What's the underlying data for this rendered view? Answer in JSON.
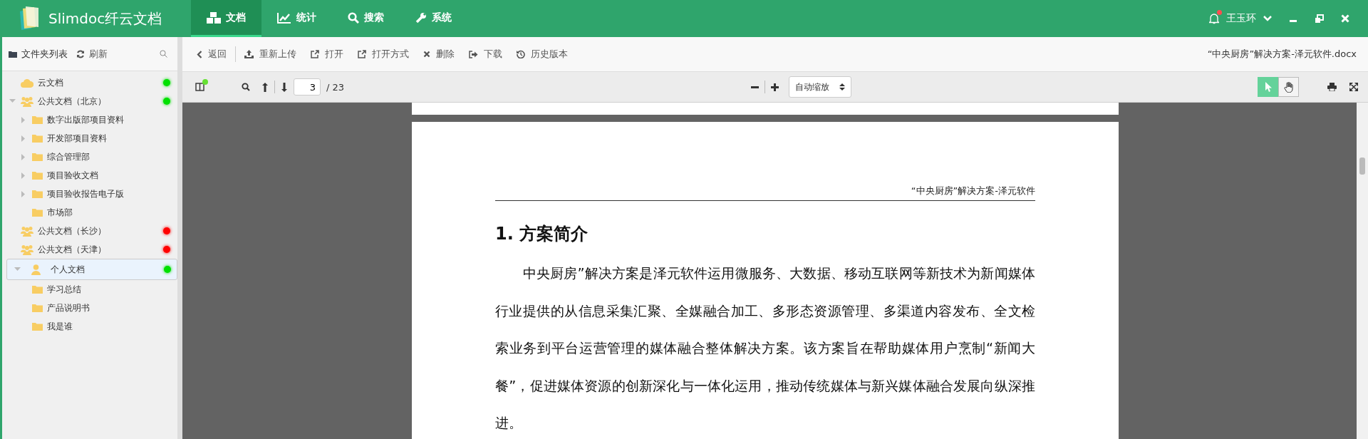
{
  "app": {
    "name": "Slimdoc纤云文档"
  },
  "nav": [
    {
      "label": "文档",
      "selected": true
    },
    {
      "label": "统计",
      "selected": false
    },
    {
      "label": "搜索",
      "selected": false
    },
    {
      "label": "系统",
      "selected": false
    }
  ],
  "user": {
    "name": "王玉环",
    "has_notification": true
  },
  "sidebar": {
    "title": "文件夹列表",
    "refresh": "刷新",
    "items": [
      {
        "label": "云文档",
        "kind": "cloud",
        "expandable": false,
        "expanded": false,
        "selected": false,
        "color": "#00e000"
      },
      {
        "label": "公共文档（北京）",
        "kind": "group",
        "expandable": true,
        "expanded": true,
        "selected": false,
        "color": "#00e000",
        "children": [
          {
            "label": "数字出版部项目资料",
            "kind": "folder",
            "expandable": true,
            "expanded": false,
            "selected": false
          },
          {
            "label": "开发部项目资料",
            "kind": "folder",
            "expandable": true,
            "expanded": false,
            "selected": false
          },
          {
            "label": "综合管理部",
            "kind": "folder",
            "expandable": true,
            "expanded": false,
            "selected": false
          },
          {
            "label": "项目验收文档",
            "kind": "folder",
            "expandable": true,
            "expanded": false,
            "selected": false
          },
          {
            "label": "项目验收报告电子版",
            "kind": "folder",
            "expandable": true,
            "expanded": false,
            "selected": false
          },
          {
            "label": "市场部",
            "kind": "folder",
            "expandable": false,
            "expanded": false,
            "selected": false
          }
        ]
      },
      {
        "label": "公共文档（长沙）",
        "kind": "group",
        "expandable": false,
        "expanded": false,
        "selected": false,
        "color": "#ff0000"
      },
      {
        "label": "公共文档（天津）",
        "kind": "group",
        "expandable": false,
        "expanded": false,
        "selected": false,
        "color": "#ff0000"
      },
      {
        "label": "个人文档",
        "kind": "person",
        "expandable": true,
        "expanded": true,
        "selected": true,
        "color": "#00e000",
        "children": [
          {
            "label": "学习总结",
            "kind": "folder",
            "expandable": false,
            "expanded": false,
            "selected": false
          },
          {
            "label": "产品说明书",
            "kind": "folder",
            "expandable": false,
            "expanded": false,
            "selected": false
          },
          {
            "label": "我是谁",
            "kind": "folder",
            "expandable": false,
            "expanded": false,
            "selected": false
          }
        ]
      }
    ]
  },
  "toolbar": {
    "actions": [
      "返回",
      "重新上传",
      "打开",
      "打开方式",
      "删除",
      "下载",
      "历史版本"
    ],
    "filename": "“中央厨房”解决方案-泽元软件.docx"
  },
  "viewer": {
    "page": "3",
    "total": "/ 23",
    "zoom": "自动缩放",
    "tools": [
      {
        "kind": "cursor",
        "selected": true
      },
      {
        "kind": "hand",
        "selected": false
      }
    ]
  },
  "document": {
    "header": "“中央厨房”解决方案-泽元软件",
    "heading": "1.  方案简介",
    "paragraph": "中央厨房”解决方案是泽元软件运用微服务、大数据、移动互联网等新技术为新闻媒体行业提供的从信息采集汇聚、全媒融合加工、多形态资源管理、多渠道内容发布、全文检索业务到平台运营管理的媒体融合整体解决方案。该方案旨在帮助媒体用户烹制“新闻大餐”，促进媒体资源的创新深化与一体化运用，推动传统媒体与新兴媒体融合发展向纵深推进。"
  }
}
